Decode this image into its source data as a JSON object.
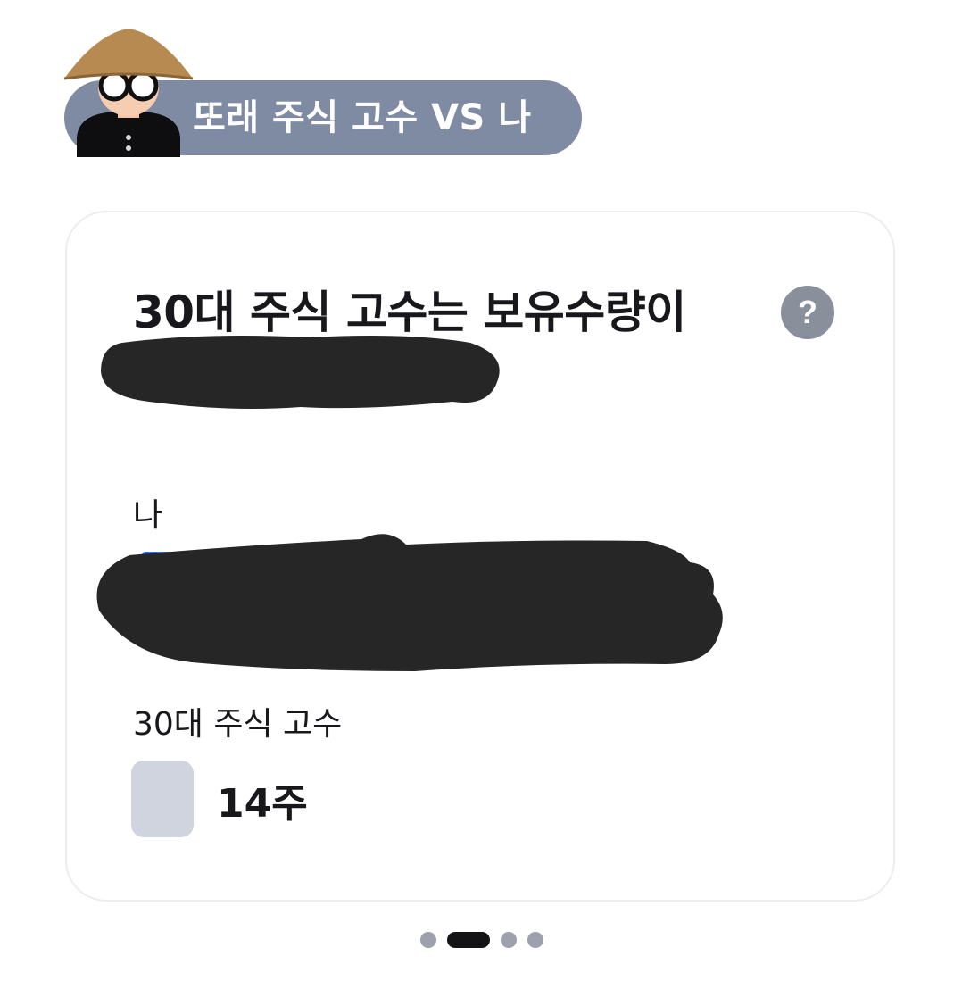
{
  "header": {
    "title": "또래 주식 고수 VS 나",
    "avatar_icon": "farmer-avatar-icon"
  },
  "card": {
    "title": "30대 주식 고수는 보유수량이",
    "help_label": "?",
    "help_icon": "question-circle-icon",
    "me": {
      "label": "나"
    },
    "expert": {
      "label": "30대 주식 고수",
      "value": "14주",
      "swatch_color": "#cfd4de"
    },
    "me_bar_color": "#2f6ff0"
  },
  "pager": {
    "total": 4,
    "active_index": 1
  }
}
